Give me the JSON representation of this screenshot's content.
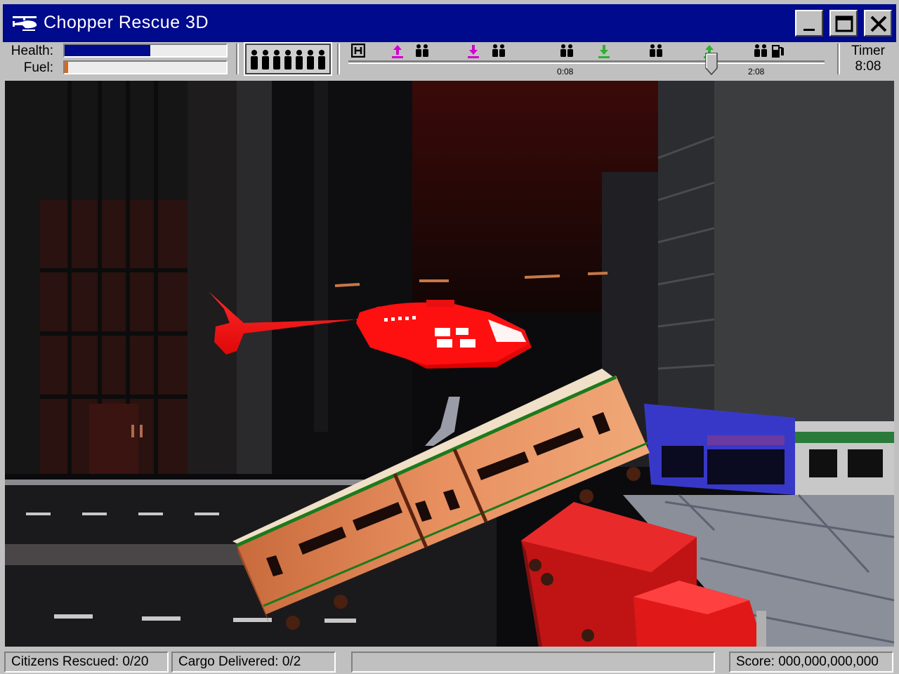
{
  "window": {
    "title": "Chopper Rescue 3D",
    "title_icon": "helicopter-icon",
    "buttons": [
      "minimize-icon",
      "maximize-icon",
      "close-icon"
    ]
  },
  "hud": {
    "health_label": "Health:",
    "fuel_label": "Fuel:",
    "health_fraction": 0.53,
    "fuel_fraction": 0.02,
    "health_color": "#000a8c",
    "fuel_color": "#d86a18",
    "passengers_aboard_icon": "people-icon",
    "timeline": {
      "markers": [
        "helipad-icon",
        "pickup-cargo-icon",
        "citizens-icon",
        "dropoff-cargo-icon",
        "citizens-icon",
        "citizens-icon",
        "dropoff-icon",
        "citizens-icon",
        "pickup-icon",
        "citizens-icon",
        "fuel-pump-icon"
      ],
      "time_start": "0:08",
      "time_end": "2:08"
    },
    "timer_label": "Timer",
    "timer_value": "8:08"
  },
  "status": {
    "citizens": "Citizens Rescued: 0/20",
    "cargo": "Cargo Delivered: 0/2",
    "message": "",
    "score": "Score: 000,000,000,000"
  },
  "colors": {
    "titlebar": "#000a8c",
    "helicopter": "#ff1010",
    "tram": "#e88858",
    "truck": "#e01818",
    "shop_front": "#3838c8"
  }
}
